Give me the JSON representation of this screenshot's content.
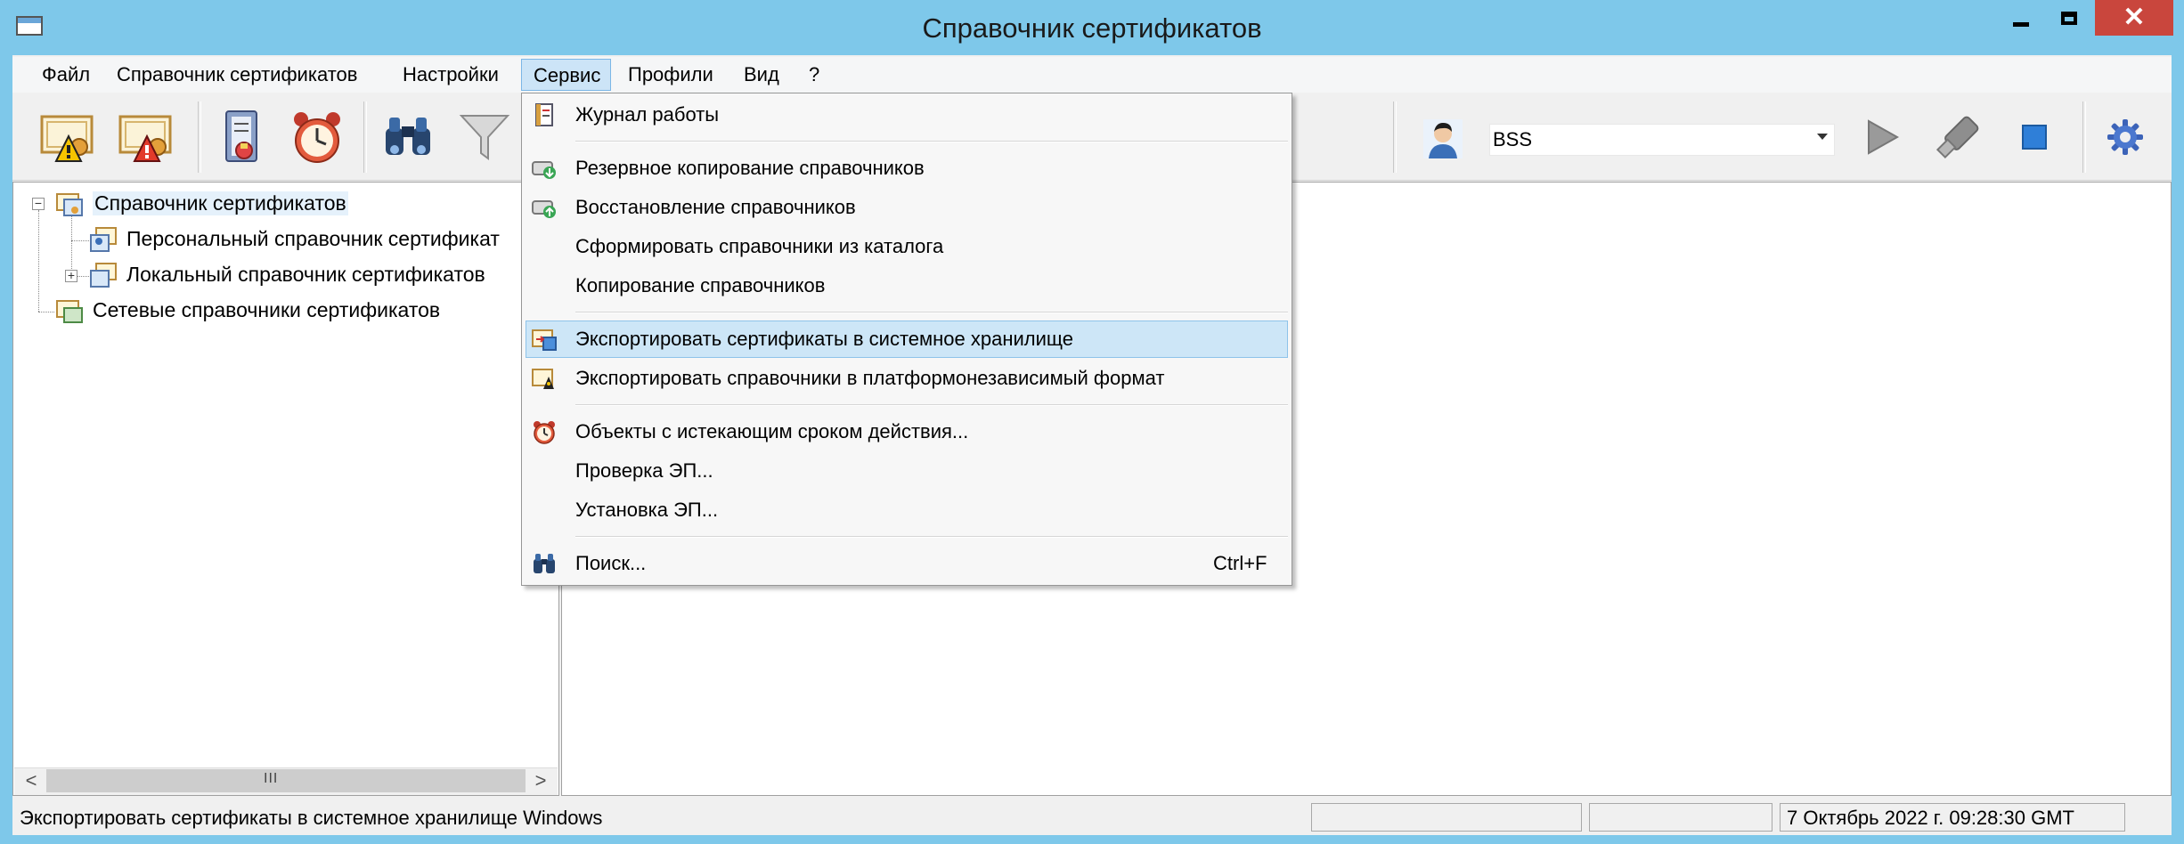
{
  "window": {
    "title": "Справочник сертификатов",
    "controls": {
      "minimize": "▬",
      "maximize": "□",
      "close": "✕"
    }
  },
  "menubar": {
    "items": [
      "Файл",
      "Справочник сертификатов",
      "Настройки",
      "Сервис",
      "Профили",
      "Вид",
      "?"
    ],
    "active": "Сервис"
  },
  "toolbar": {
    "icons": [
      "certificate-warning-icon",
      "certificate-error-icon",
      "revocation-list-icon",
      "alarm-clock-icon",
      "binoculars-icon",
      "filter-icon",
      "user-avatar-icon",
      "play-icon",
      "usb-token-icon",
      "stop-icon",
      "settings-gear-icon"
    ],
    "profile": {
      "value": "BSS"
    }
  },
  "tree": {
    "items": [
      {
        "label": "Справочник сертификатов",
        "level": 0,
        "expander": "−"
      },
      {
        "label": "Персональный справочник сертификат",
        "level": 1
      },
      {
        "label": "Локальный справочник сертификатов",
        "level": 1,
        "expander": "+"
      },
      {
        "label": "Сетевые справочники сертификатов",
        "level": 0
      }
    ]
  },
  "scrollbar": {
    "left": "<",
    "right": ">",
    "grip": "III"
  },
  "service_menu": {
    "items": [
      {
        "label": "Журнал работы",
        "icon": "journal-icon"
      },
      {
        "label": "Резервное копирование справочников",
        "icon": "backup-icon"
      },
      {
        "label": "Восстановление справочников",
        "icon": "restore-icon"
      },
      {
        "label": "Сформировать справочники из каталога",
        "icon": ""
      },
      {
        "label": "Копирование справочников",
        "icon": ""
      },
      {
        "label": "Экспортировать сертификаты в системное хранилище",
        "icon": "export-store-icon",
        "highlighted": true
      },
      {
        "label": "Экспортировать справочники в платформонезависимый формат",
        "icon": "export-format-icon"
      },
      {
        "label": "Объекты с истекающим сроком действия...",
        "icon": "alarm-clock-icon"
      },
      {
        "label": "Проверка ЭП...",
        "icon": ""
      },
      {
        "label": "Установка ЭП...",
        "icon": ""
      },
      {
        "label": "Поиск...",
        "icon": "binoculars-icon",
        "shortcut": "Ctrl+F"
      }
    ]
  },
  "statusbar": {
    "message": "Экспортировать сертификаты в системное хранилище Windows",
    "datetime": "7 Октябрь 2022 г. 09:28:30 GMT"
  },
  "colors": {
    "titlebar": "#7ec8ea",
    "close_button": "#c9463d",
    "menu_highlight": "#cde6f7",
    "active_menu": "#cce4f7"
  }
}
